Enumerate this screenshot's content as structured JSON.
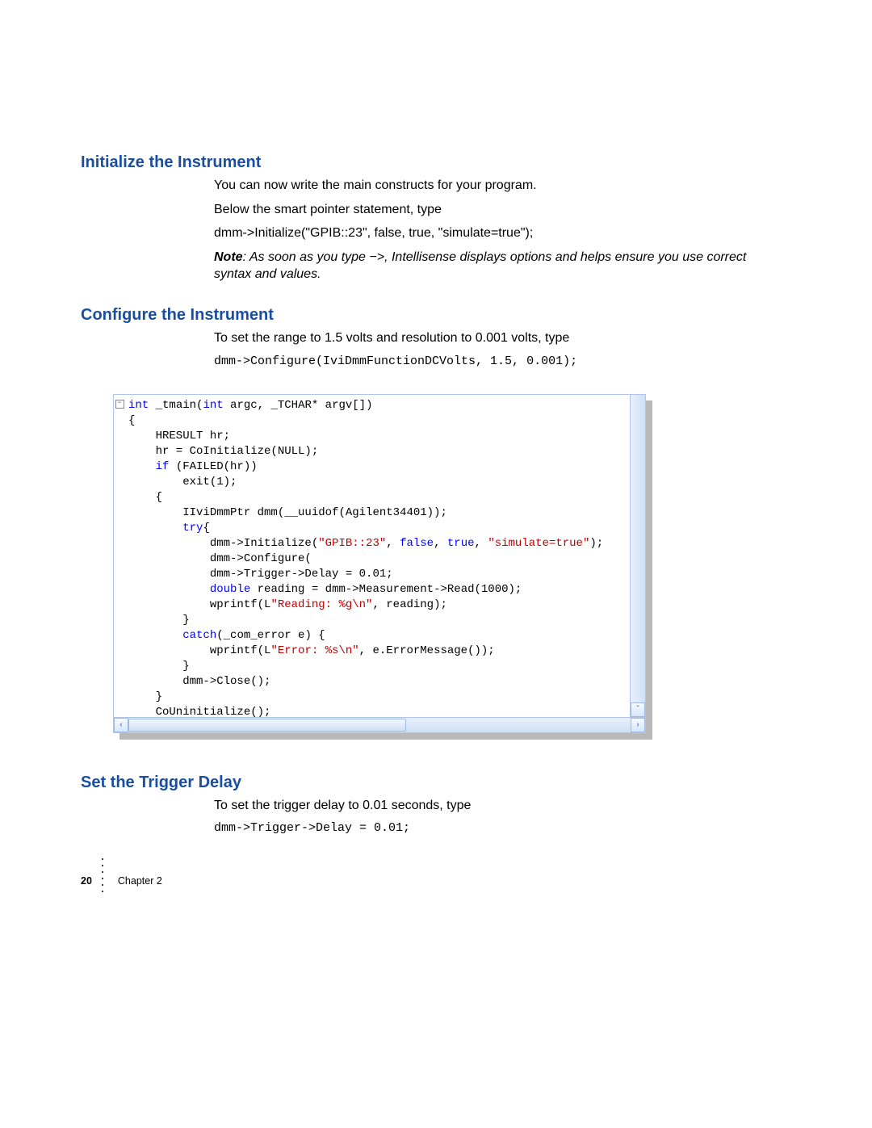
{
  "section1": {
    "heading": "Initialize the Instrument",
    "p1": "You can now write the main constructs for your program.",
    "p2": "Below the smart pointer statement, type",
    "p3": "dmm->Initialize(\"GPIB::23\", false, true, \"simulate=true\");",
    "note_label": "Note",
    "note_text": ": As soon as you type −>, Intellisense displays options and helps ensure you use correct syntax and values."
  },
  "section2": {
    "heading": "Configure the Instrument",
    "p1": "To set the range to 1.5 volts and resolution to 0.001 volts, type",
    "p2": "dmm->Configure(IviDmmFunctionDCVolts, 1.5, 0.001);"
  },
  "editor": {
    "collapse_glyph": "−",
    "scroll_left": "‹",
    "scroll_right": "›",
    "scroll_down": "ˇ",
    "tokens": [
      [
        [
          "kw",
          "int"
        ],
        [
          "",
          " _tmain("
        ],
        [
          "kw",
          "int"
        ],
        [
          "",
          " argc, _TCHAR* argv[])"
        ]
      ],
      [
        [
          "",
          "{"
        ]
      ],
      [
        [
          "",
          "    HRESULT hr;"
        ]
      ],
      [
        [
          "",
          "    hr = CoInitialize(NULL);"
        ]
      ],
      [
        [
          "",
          "    "
        ],
        [
          "kw",
          "if"
        ],
        [
          "",
          " (FAILED(hr))"
        ]
      ],
      [
        [
          "",
          "        exit(1);"
        ]
      ],
      [
        [
          "",
          "    {"
        ]
      ],
      [
        [
          "",
          "        IIviDmmPtr dmm(__uuidof(Agilent34401));"
        ]
      ],
      [
        [
          "",
          "        "
        ],
        [
          "kw",
          "try"
        ],
        [
          "",
          "{"
        ]
      ],
      [
        [
          "",
          "            dmm->Initialize("
        ],
        [
          "str",
          "\"GPIB::23\""
        ],
        [
          "",
          ", "
        ],
        [
          "kw",
          "false"
        ],
        [
          "",
          ", "
        ],
        [
          "kw",
          "true"
        ],
        [
          "",
          ", "
        ],
        [
          "str",
          "\"simulate=true\""
        ],
        [
          "",
          ");"
        ]
      ],
      [
        [
          "",
          "            dmm->Configure("
        ]
      ],
      [
        [
          "",
          "            dmm->Trigger->Delay = 0.01;"
        ]
      ],
      [
        [
          "",
          "            "
        ],
        [
          "kw",
          "double"
        ],
        [
          "",
          " reading = dmm->Measurement->Read(1000);"
        ]
      ],
      [
        [
          "",
          "            wprintf(L"
        ],
        [
          "str",
          "\"Reading: %g\\n\""
        ],
        [
          "",
          ", reading);"
        ]
      ],
      [
        [
          "",
          "        }"
        ]
      ],
      [
        [
          "",
          "        "
        ],
        [
          "kw",
          "catch"
        ],
        [
          "",
          "(_com_error e) {"
        ]
      ],
      [
        [
          "",
          "            wprintf(L"
        ],
        [
          "str",
          "\"Error: %s\\n\""
        ],
        [
          "",
          ", e.ErrorMessage());"
        ]
      ],
      [
        [
          "",
          "        }"
        ]
      ],
      [
        [
          "",
          "        dmm->Close();"
        ]
      ],
      [
        [
          "",
          "    }"
        ]
      ],
      [
        [
          "",
          "    CoUninitialize();"
        ]
      ],
      [
        [
          "",
          "}"
        ]
      ]
    ]
  },
  "section3": {
    "heading": "Set the Trigger Delay",
    "p1": "To set the trigger delay to 0.01 seconds, type",
    "p2": "dmm->Trigger->Delay = 0.01;"
  },
  "footer": {
    "page": "20",
    "chapter": "Chapter 2"
  }
}
